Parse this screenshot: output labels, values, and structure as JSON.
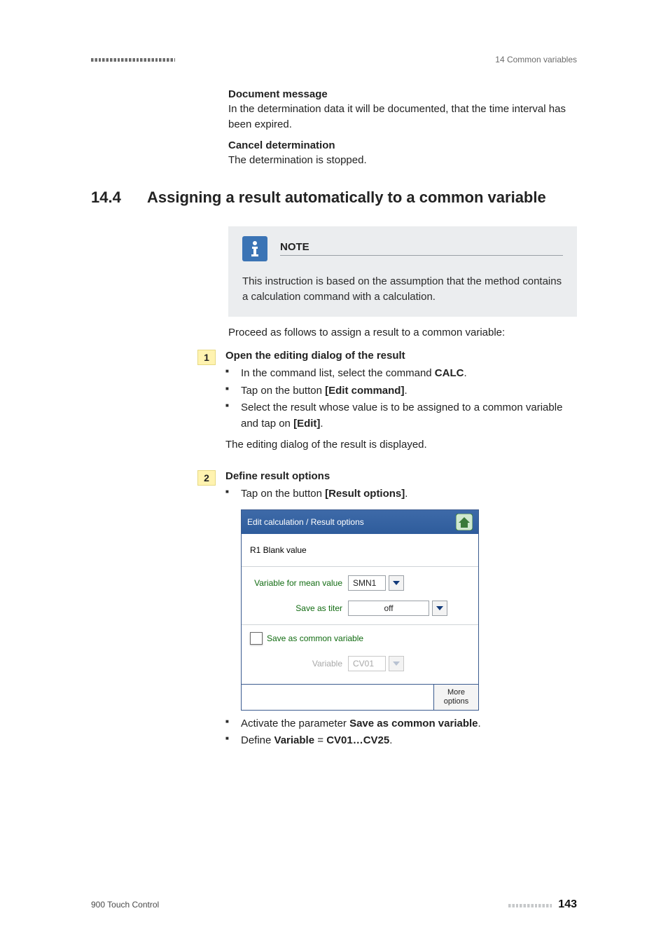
{
  "header": {
    "breadcrumb": "14 Common variables"
  },
  "intro": {
    "docmsg_title": "Document message",
    "docmsg_text": "In the determination data it will be documented, that the time interval has been expired.",
    "cancel_title": "Cancel determination",
    "cancel_text": "The determination is stopped."
  },
  "section": {
    "number": "14.4",
    "title": "Assigning a result automatically to a common variable"
  },
  "note": {
    "label": "NOTE",
    "text": "This instruction is based on the assumption that the method contains a calculation command with a calculation."
  },
  "lead": "Proceed as follows to assign a result to a common variable:",
  "steps": [
    {
      "num": "1",
      "title": "Open the editing dialog of the result",
      "bullets": [
        {
          "pre": "In the command list, select the command ",
          "bold": "CALC",
          "post": "."
        },
        {
          "pre": "Tap on the button ",
          "bold": "[Edit command]",
          "post": "."
        },
        {
          "pre": "Select the result whose value is to be assigned to a common variable and tap on ",
          "bold": "[Edit]",
          "post": "."
        }
      ],
      "outcome": "The editing dialog of the result is displayed."
    },
    {
      "num": "2",
      "title": "Define result options",
      "bullets": [
        {
          "pre": "Tap on the button ",
          "bold": "[Result options]",
          "post": "."
        }
      ]
    }
  ],
  "dialog": {
    "title": "Edit calculation / Result options",
    "row_header": "R1  Blank value",
    "mean_label": "Variable for mean value",
    "mean_value": "SMN1",
    "titer_label": "Save as titer",
    "titer_value": "off",
    "save_cv_label": "Save as common variable",
    "var_label": "Variable",
    "var_value": "CV01",
    "more_btn": "More options"
  },
  "post_bullets": [
    {
      "pre": "Activate the parameter ",
      "bold": "Save as common variable",
      "post": "."
    },
    {
      "pre": "Define ",
      "bold": "Variable",
      "mid": " = ",
      "bold2": "CV01…CV25",
      "post": "."
    }
  ],
  "footer": {
    "product": "900 Touch Control",
    "page": "143"
  }
}
